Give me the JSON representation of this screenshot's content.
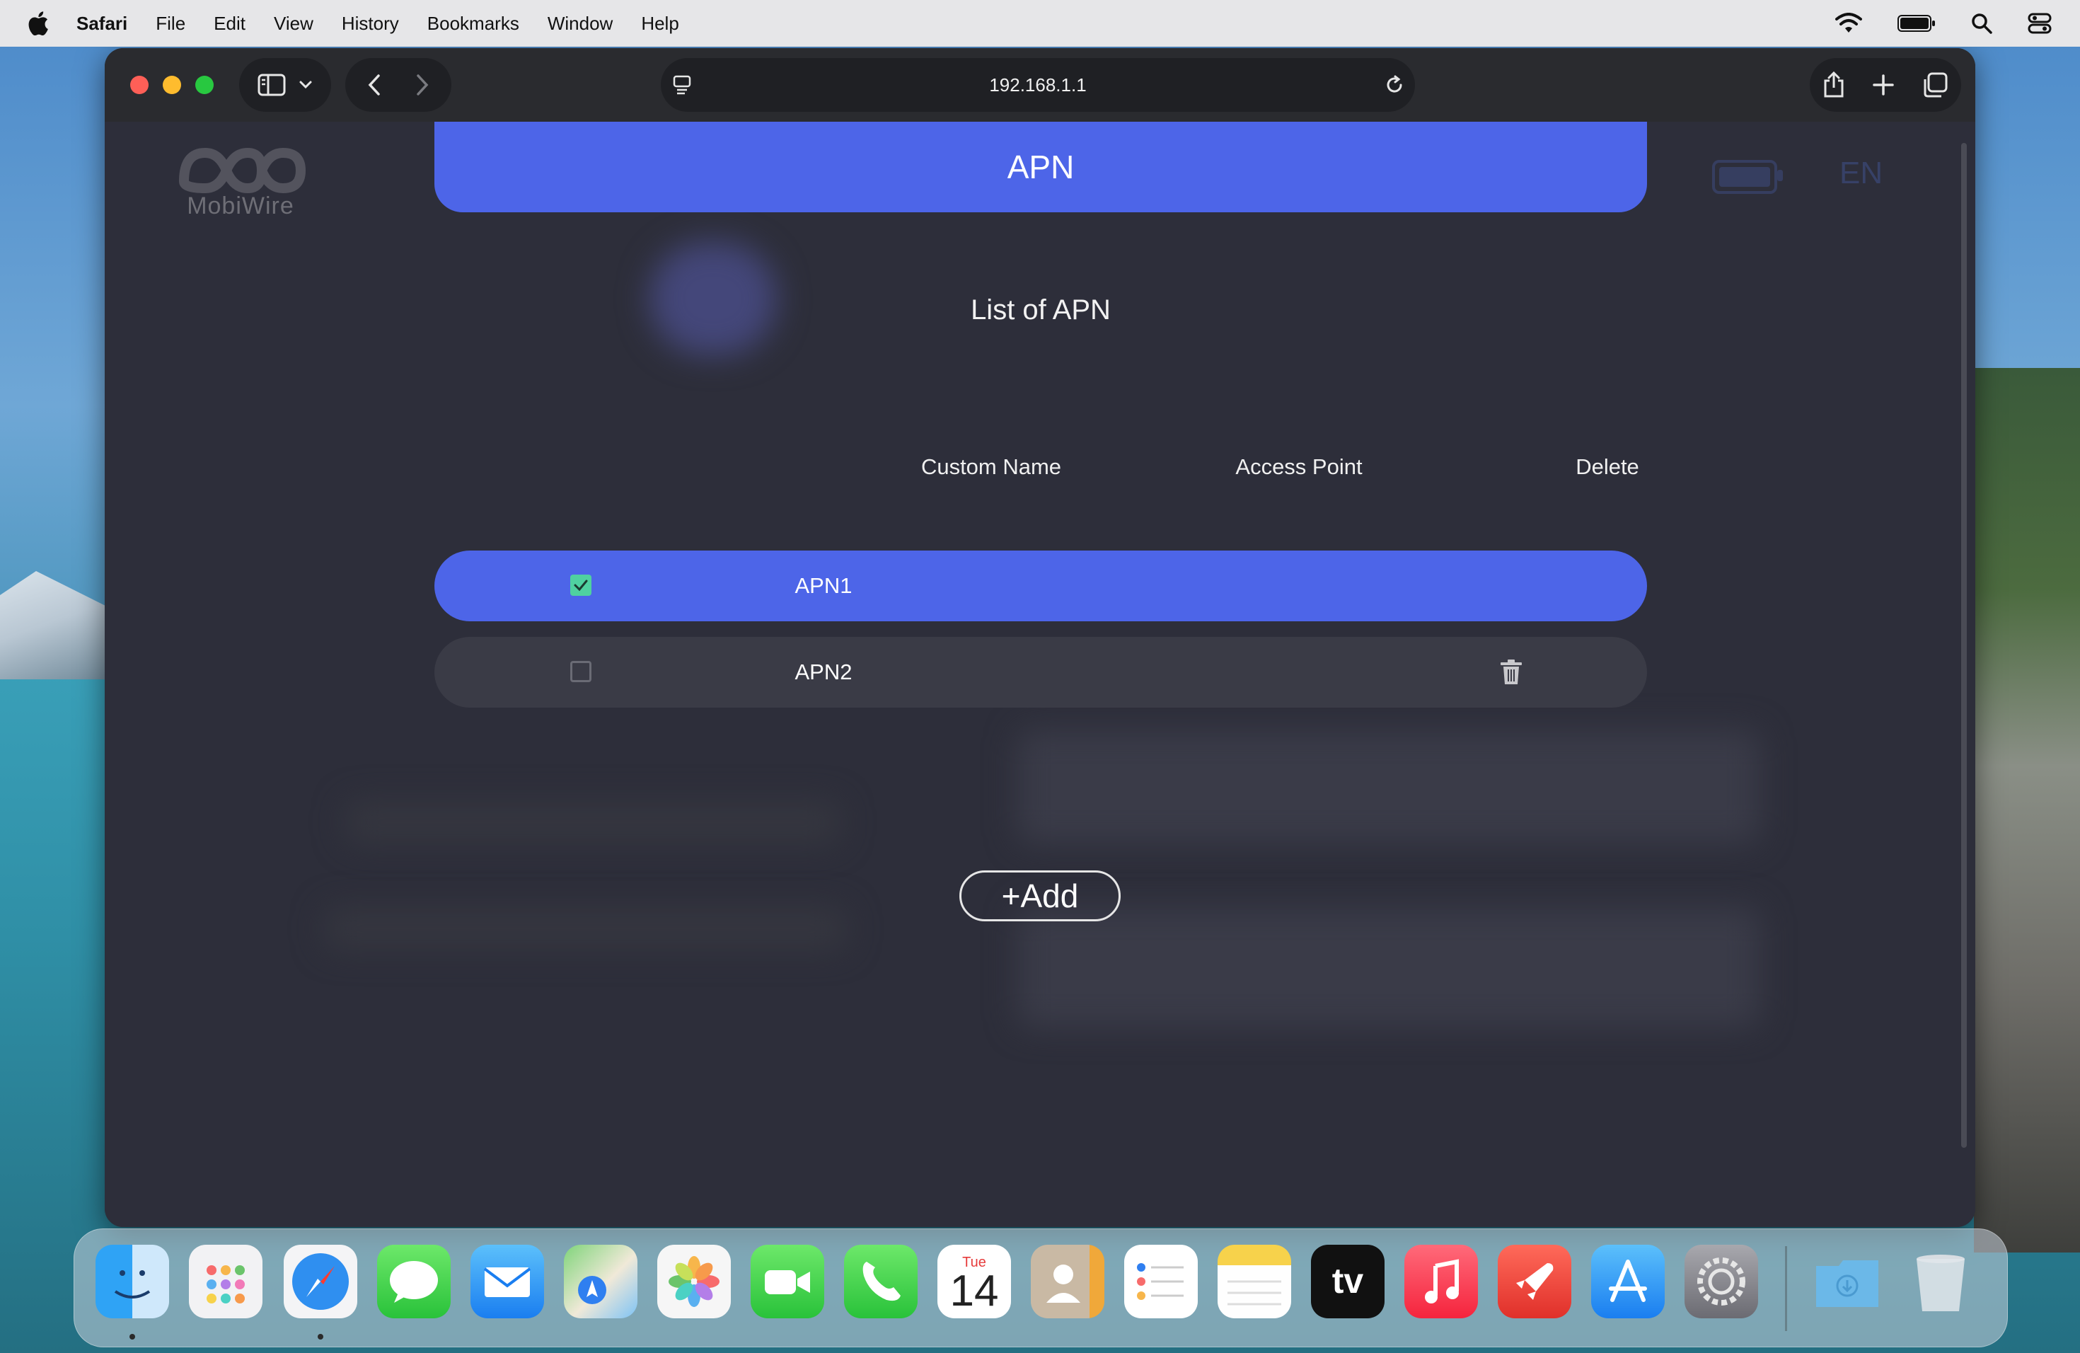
{
  "menubar": {
    "app_name": "Safari",
    "items": [
      "File",
      "Edit",
      "View",
      "History",
      "Bookmarks",
      "Window",
      "Help"
    ]
  },
  "browser": {
    "url": "192.168.1.1"
  },
  "page": {
    "logo_text": "MobiWire",
    "language": "EN",
    "header_title": "APN",
    "list_title": "List of APN",
    "columns": [
      "Custom Name",
      "Access Point",
      "Delete"
    ],
    "rows": [
      {
        "name": "APN1",
        "checked": true,
        "selected": true
      },
      {
        "name": "APN2",
        "checked": false,
        "selected": false
      }
    ],
    "add_label": "+Add"
  },
  "colors": {
    "accent": "#4d65e8",
    "check": "#4fd1a0",
    "page_bg": "#2d2e3a"
  },
  "dock": {
    "calendar_day": "Tue",
    "calendar_date": "14",
    "tv_label": "tv",
    "apps": [
      "finder-icon",
      "launchpad-icon",
      "safari-icon",
      "messages-icon",
      "mail-icon",
      "maps-icon",
      "photos-icon",
      "facetime-icon",
      "phone-icon",
      "calendar-icon",
      "contacts-icon",
      "reminders-icon",
      "notes-icon",
      "apple-tv-icon",
      "music-icon",
      "rocket-icon",
      "app-store-icon",
      "system-settings-icon",
      "downloads-folder-icon",
      "trash-icon"
    ]
  }
}
